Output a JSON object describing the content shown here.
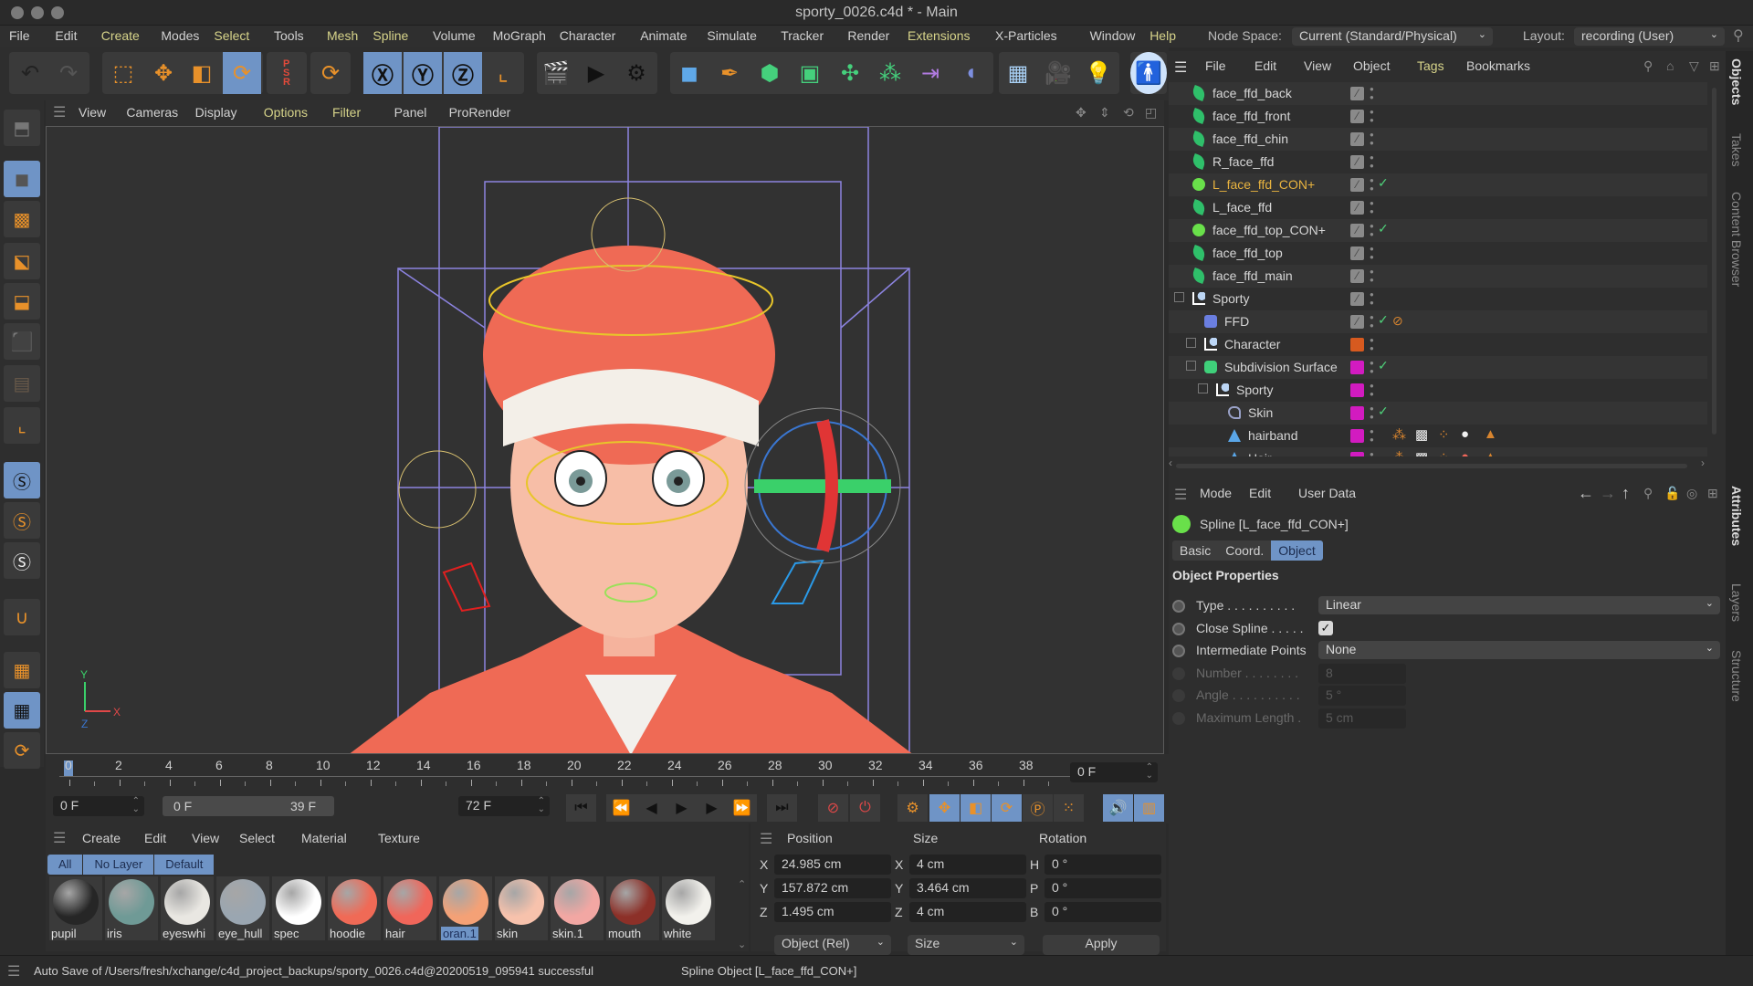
{
  "window": {
    "title": "sporty_0026.c4d * - Main"
  },
  "menubar": {
    "items": [
      {
        "label": "File",
        "hl": false
      },
      {
        "label": "Edit",
        "hl": false
      },
      {
        "label": "Create",
        "hl": true
      },
      {
        "label": "Modes",
        "hl": false
      },
      {
        "label": "Select",
        "hl": true
      },
      {
        "label": "Tools",
        "hl": false
      },
      {
        "label": "Mesh",
        "hl": true
      },
      {
        "label": "Spline",
        "hl": true
      },
      {
        "label": "Volume",
        "hl": false
      },
      {
        "label": "MoGraph",
        "hl": false
      },
      {
        "label": "Character",
        "hl": false
      },
      {
        "label": "Animate",
        "hl": false
      },
      {
        "label": "Simulate",
        "hl": false
      },
      {
        "label": "Tracker",
        "hl": false
      },
      {
        "label": "Render",
        "hl": false
      },
      {
        "label": "Extensions",
        "hl": true
      },
      {
        "label": "X-Particles",
        "hl": false
      },
      {
        "label": "Window",
        "hl": false
      },
      {
        "label": "Help",
        "hl": true
      }
    ],
    "node_space_label": "Node Space:",
    "node_space_value": "Current (Standard/Physical)",
    "layout_label": "Layout:",
    "layout_value": "recording (User)"
  },
  "toolbar": {
    "icons": [
      "undo-icon",
      "redo-icon",
      "live-selection-icon",
      "move-icon",
      "scale-icon",
      "rotate-icon",
      "psr-reset-icon",
      "recent-tools-icon",
      "x-axis-lock-icon",
      "y-axis-lock-icon",
      "z-axis-lock-icon",
      "coordinate-system-icon",
      "render-view-icon",
      "render-to-picture-viewer-icon",
      "render-settings-icon",
      "cube-icon",
      "pen-icon",
      "subdivision-surface-icon",
      "extrude-icon",
      "mograph-cloner-icon",
      "array-icon",
      "bend-deformer-icon",
      "bend-icon",
      "floor-icon",
      "camera-icon",
      "light-icon",
      "character-icon"
    ]
  },
  "leftbar": {
    "icons": [
      "make-editable-icon",
      "model-mode-icon",
      "texture-mode-icon",
      "points-mode-icon",
      "edges-mode-icon",
      "polygons-mode-icon",
      "uv-mode-icon",
      "axis-mode-icon",
      "snap-icon",
      "soft-selection-icon",
      "sculpt-icon",
      "magnet-icon",
      "workplane-icon",
      "lock-workplane-icon",
      "workplane-align-icon"
    ]
  },
  "viewport": {
    "menu": [
      {
        "label": "View",
        "hl": false
      },
      {
        "label": "Cameras",
        "hl": false
      },
      {
        "label": "Display",
        "hl": false
      },
      {
        "label": "Options",
        "hl": true
      },
      {
        "label": "Filter",
        "hl": true
      },
      {
        "label": "Panel",
        "hl": false
      },
      {
        "label": "ProRender",
        "hl": false
      }
    ],
    "axis": {
      "x": "X",
      "y": "Y",
      "z": "Z"
    }
  },
  "timeline": {
    "ticks": [
      "0",
      "2",
      "4",
      "6",
      "8",
      "10",
      "12",
      "14",
      "16",
      "18",
      "20",
      "22",
      "24",
      "26",
      "28",
      "30",
      "32",
      "34",
      "36",
      "38"
    ],
    "current_frame": "0 F",
    "start_field": "0 F",
    "range_start": "0 F",
    "range_end": "39 F",
    "end_field": "72 F"
  },
  "materials": {
    "menu": [
      "Create",
      "Edit",
      "View",
      "Select",
      "Material",
      "Texture"
    ],
    "filters": [
      "All",
      "No Layer",
      "Default"
    ],
    "items": [
      {
        "name": "pupil",
        "color": "#262626",
        "sel": false
      },
      {
        "name": "iris",
        "color": "#6f9a96",
        "sel": false
      },
      {
        "name": "eyeswhi",
        "color": "#e9e7e2",
        "sel": false
      },
      {
        "name": "eye_hull",
        "color": "#9aa6b1",
        "sel": false
      },
      {
        "name": "spec",
        "color": "#ffffff",
        "sel": false
      },
      {
        "name": "hoodie",
        "color": "#f06a56",
        "sel": false
      },
      {
        "name": "hair",
        "color": "#f0665a",
        "sel": false
      },
      {
        "name": "oran.1",
        "color": "#f4a176",
        "sel": true
      },
      {
        "name": "skin",
        "color": "#f7c2ac",
        "sel": false
      },
      {
        "name": "skin.1",
        "color": "#f2a7a3",
        "sel": false
      },
      {
        "name": "mouth",
        "color": "#8c3028",
        "sel": false
      },
      {
        "name": "white",
        "color": "#f2f1ec",
        "sel": false
      }
    ]
  },
  "coords": {
    "headers": [
      "Position",
      "Size",
      "Rotation"
    ],
    "rows": [
      {
        "pl": "X",
        "pv": "24.985 cm",
        "sl": "X",
        "sv": "4 cm",
        "rl": "H",
        "rv": "0 °"
      },
      {
        "pl": "Y",
        "pv": "157.872 cm",
        "sl": "Y",
        "sv": "3.464 cm",
        "rl": "P",
        "rv": "0 °"
      },
      {
        "pl": "Z",
        "pv": "1.495 cm",
        "sl": "Z",
        "sv": "4 cm",
        "rl": "B",
        "rv": "0 °"
      }
    ],
    "mode": "Object (Rel)",
    "size_mode": "Size",
    "apply": "Apply"
  },
  "objects": {
    "menu": [
      {
        "label": "File",
        "hl": false
      },
      {
        "label": "Edit",
        "hl": false
      },
      {
        "label": "View",
        "hl": false
      },
      {
        "label": "Object",
        "hl": false
      },
      {
        "label": "Tags",
        "hl": true
      },
      {
        "label": "Bookmarks",
        "hl": false
      }
    ],
    "rows": [
      {
        "name": "face_ffd_back",
        "icon": "spline-pen-icon",
        "depth": 0,
        "layer": "#8a8a8a",
        "check": false,
        "sel": false
      },
      {
        "name": "face_ffd_front",
        "icon": "spline-pen-icon",
        "depth": 0,
        "layer": "#8a8a8a",
        "check": false,
        "sel": false
      },
      {
        "name": "face_ffd_chin",
        "icon": "spline-pen-icon",
        "depth": 0,
        "layer": "#8a8a8a",
        "check": false,
        "sel": false
      },
      {
        "name": "R_face_ffd",
        "icon": "spline-pen-icon",
        "depth": 0,
        "layer": "#8a8a8a",
        "check": false,
        "sel": false
      },
      {
        "name": "L_face_ffd_CON+",
        "icon": "spline-circle-icon",
        "depth": 0,
        "layer": "#8a8a8a",
        "check": true,
        "sel": true
      },
      {
        "name": "L_face_ffd",
        "icon": "spline-pen-icon",
        "depth": 0,
        "layer": "#8a8a8a",
        "check": false,
        "sel": false
      },
      {
        "name": "face_ffd_top_CON+",
        "icon": "spline-circle-icon",
        "depth": 0,
        "layer": "#8a8a8a",
        "check": true,
        "sel": false
      },
      {
        "name": "face_ffd_top",
        "icon": "spline-pen-icon",
        "depth": 0,
        "layer": "#8a8a8a",
        "check": false,
        "sel": false
      },
      {
        "name": "face_ffd_main",
        "icon": "spline-pen-icon",
        "depth": 0,
        "layer": "#8a8a8a",
        "check": false,
        "sel": false
      },
      {
        "name": "Sporty",
        "icon": "null-icon",
        "depth": 0,
        "layer": "#8a8a8a",
        "check": false,
        "sel": false
      },
      {
        "name": "FFD",
        "icon": "ffd-icon",
        "depth": 1,
        "layer": "#8a8a8a",
        "check": true,
        "sel": false
      },
      {
        "name": "Character",
        "icon": "null-icon",
        "depth": 1,
        "layer": "#d75a1f",
        "check": false,
        "sel": false
      },
      {
        "name": "Subdivision Surface",
        "icon": "subdivision-icon",
        "depth": 1,
        "layer": "#d21bc0",
        "check": true,
        "sel": false
      },
      {
        "name": "Sporty",
        "icon": "null-icon",
        "depth": 2,
        "layer": "#d21bc0",
        "check": false,
        "sel": false
      },
      {
        "name": "Skin",
        "icon": "skin-icon",
        "depth": 3,
        "layer": "#d21bc0",
        "check": true,
        "sel": false
      },
      {
        "name": "hairband",
        "icon": "polygon-icon",
        "depth": 3,
        "layer": "#d21bc0",
        "check": false,
        "sel": false
      },
      {
        "name": "Hair",
        "icon": "polygon-icon",
        "depth": 3,
        "layer": "#d21bc0",
        "check": false,
        "sel": false
      }
    ]
  },
  "attributes": {
    "menu": [
      "Mode",
      "Edit",
      "User Data"
    ],
    "object_title": "Spline [L_face_ffd_CON+]",
    "tabs": [
      {
        "label": "Basic",
        "on": false
      },
      {
        "label": "Coord.",
        "on": false
      },
      {
        "label": "Object",
        "on": true
      }
    ],
    "section": "Object Properties",
    "props": [
      {
        "label": "Type . . . . . . . . . .",
        "value": "Linear",
        "kind": "dropdown",
        "dim": false
      },
      {
        "label": "Close Spline . . . . .",
        "value": "✓",
        "kind": "checkbox",
        "dim": false
      },
      {
        "label": "Intermediate Points",
        "value": "None",
        "kind": "dropdown",
        "dim": false
      },
      {
        "label": "Number . . . . . . . .",
        "value": "8",
        "kind": "number",
        "dim": true
      },
      {
        "label": "Angle . . . . . . . . . .",
        "value": "5 °",
        "kind": "number",
        "dim": true
      },
      {
        "label": "Maximum Length .",
        "value": "5 cm",
        "kind": "number",
        "dim": true
      }
    ]
  },
  "side_tabs": {
    "top": [
      {
        "label": "Objects",
        "on": true
      },
      {
        "label": "Takes",
        "on": false
      },
      {
        "label": "Content Browser",
        "on": false
      }
    ],
    "bottom": [
      {
        "label": "Attributes",
        "on": true
      },
      {
        "label": "Layers",
        "on": false
      },
      {
        "label": "Structure",
        "on": false
      }
    ]
  },
  "status": {
    "message": "Auto Save of /Users/fresh/xchange/c4d_project_backups/sporty_0026.c4d@20200519_095941 successful",
    "selection": "Spline Object [L_face_ffd_CON+]"
  }
}
